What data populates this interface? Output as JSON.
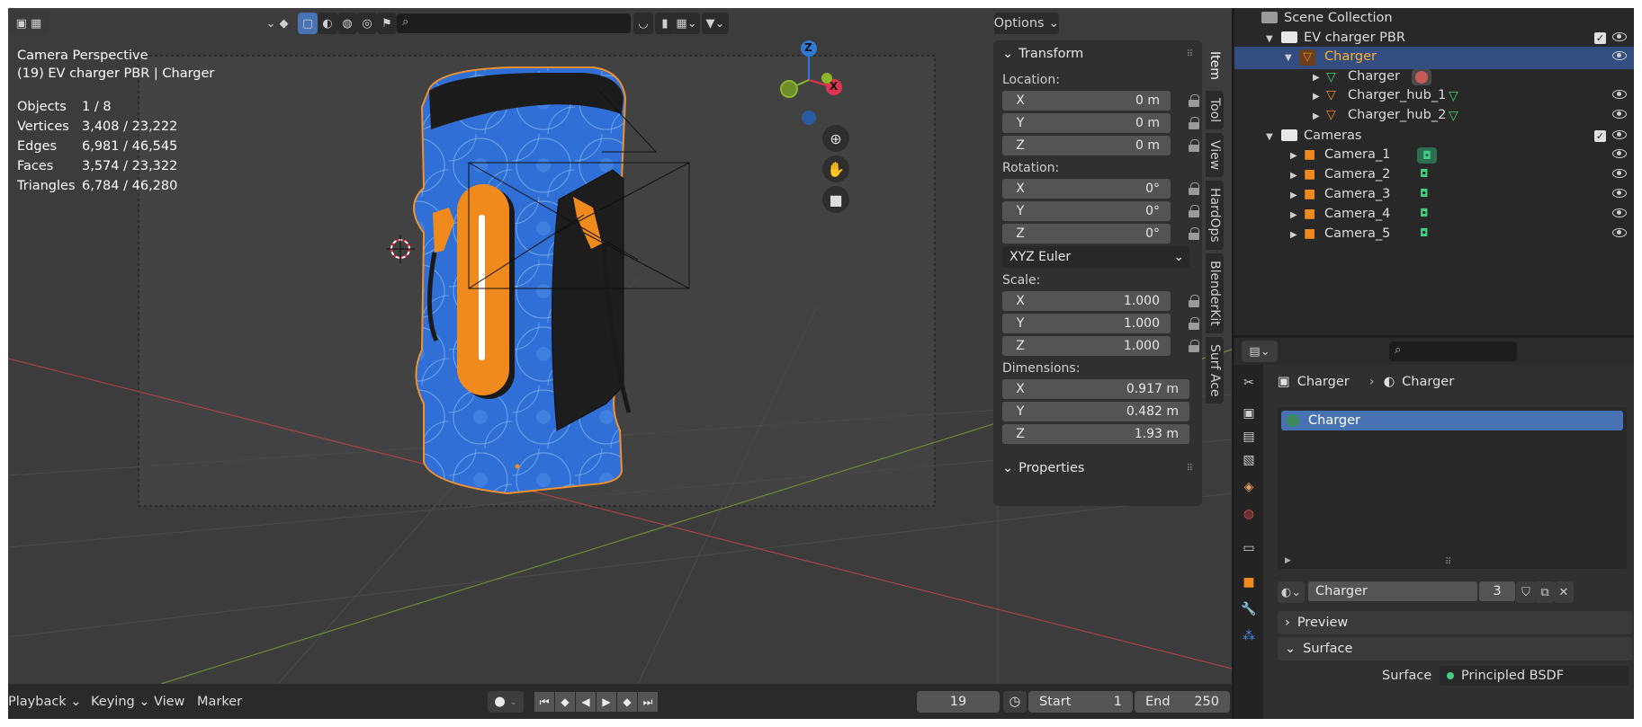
{
  "viewport": {
    "search_placeholder": "",
    "options_label": "Options",
    "view_mode": "Camera Perspective",
    "object_path": "(19) EV charger PBR | Charger",
    "stats": [
      {
        "label": "Objects",
        "value": "1 / 8"
      },
      {
        "label": "Vertices",
        "value": "3,408 / 23,222"
      },
      {
        "label": "Edges",
        "value": "6,981 / 46,545"
      },
      {
        "label": "Faces",
        "value": "3,574 / 23,322"
      },
      {
        "label": "Triangles",
        "value": "6,784 / 46,280"
      }
    ],
    "gizmo": {
      "z": "Z",
      "x": "X"
    },
    "colors": {
      "axis_x": "#e0334f",
      "axis_y": "#8bb62a",
      "axis_z": "#2e7ad6",
      "selection_outline": "#f0902f",
      "charger_blue": "#2f6fd6",
      "charger_orange": "#f08a1d"
    }
  },
  "npanel": {
    "transform_title": "Transform",
    "location_label": "Location:",
    "location": [
      {
        "axis": "X",
        "value": "0 m"
      },
      {
        "axis": "Y",
        "value": "0 m"
      },
      {
        "axis": "Z",
        "value": "0 m"
      }
    ],
    "rotation_label": "Rotation:",
    "rotation": [
      {
        "axis": "X",
        "value": "0°"
      },
      {
        "axis": "Y",
        "value": "0°"
      },
      {
        "axis": "Z",
        "value": "0°"
      }
    ],
    "rotation_mode": "XYZ Euler",
    "scale_label": "Scale:",
    "scale": [
      {
        "axis": "X",
        "value": "1.000"
      },
      {
        "axis": "Y",
        "value": "1.000"
      },
      {
        "axis": "Z",
        "value": "1.000"
      }
    ],
    "dimensions_label": "Dimensions:",
    "dimensions": [
      {
        "axis": "X",
        "value": "0.917 m"
      },
      {
        "axis": "Y",
        "value": "0.482 m"
      },
      {
        "axis": "Z",
        "value": "1.93 m"
      }
    ],
    "properties_title": "Properties",
    "tabs": [
      "Item",
      "Tool",
      "View",
      "HardOps",
      "BlenderKit",
      "Surf Ace"
    ]
  },
  "timeline": {
    "playback": "Playback",
    "keying": "Keying",
    "view": "View",
    "marker": "Marker",
    "current_frame": "19",
    "start_label": "Start",
    "start_value": "1",
    "end_label": "End",
    "end_value": "250"
  },
  "outliner": {
    "scene_collection": "Scene Collection",
    "rows": [
      {
        "label": "EV charger PBR"
      },
      {
        "label": "Charger"
      },
      {
        "label": "Charger"
      },
      {
        "label": "Charger_hub_1"
      },
      {
        "label": "Charger_hub_2"
      },
      {
        "label": "Cameras"
      },
      {
        "label": "Camera_1"
      },
      {
        "label": "Camera_2"
      },
      {
        "label": "Camera_3"
      },
      {
        "label": "Camera_4"
      },
      {
        "label": "Camera_5"
      }
    ]
  },
  "properties": {
    "breadcrumb_object": "Charger",
    "breadcrumb_material": "Charger",
    "material_slot": "Charger",
    "material_name": "Charger",
    "user_count": "3",
    "preview_label": "Preview",
    "surface_label": "Surface",
    "surface_field_label": "Surface",
    "surface_value": "Principled BSDF"
  }
}
